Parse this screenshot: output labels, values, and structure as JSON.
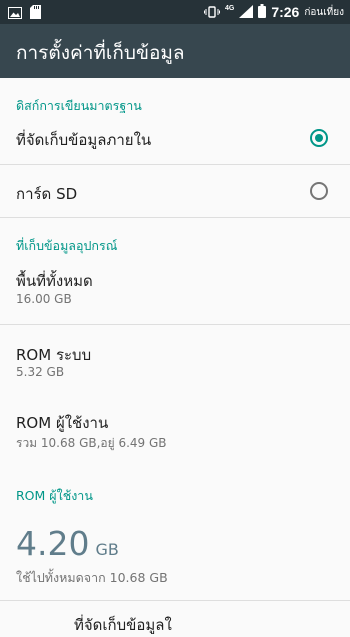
{
  "status_bar": {
    "time": "7:26",
    "ampm": "ก่อนเที่ยง",
    "network": "4G",
    "icons": [
      "image-icon",
      "sd-card-icon",
      "vibrate-icon",
      "signal-icon",
      "battery-icon"
    ]
  },
  "app_bar": {
    "title": "การตั้งค่าที่เก็บข้อมูล"
  },
  "default_disk": {
    "header": "ดิสก์การเขียนมาตรฐาน",
    "options": [
      {
        "label": "ที่จัดเก็บข้อมูลภายใน",
        "selected": true
      },
      {
        "label": "การ์ด SD",
        "selected": false
      }
    ]
  },
  "device_storage": {
    "header": "ที่เก็บข้อมูลอุปกรณ์",
    "items": [
      {
        "title": "พื้นที่ทั้งหมด",
        "value": "16.00 GB"
      },
      {
        "title": "ROM ระบบ",
        "value": "5.32 GB"
      },
      {
        "title": "ROM ผู้ใช้งาน",
        "value": "รวม 10.68 GB,อยู่ 6.49 GB"
      }
    ]
  },
  "user_rom": {
    "header": "ROM ผู้ใช้งาน",
    "used_number": "4.20",
    "used_unit": "GB",
    "caption": "ใช้ไปทั้งหมดจาก 10.68 GB"
  },
  "partial_row": {
    "text": "ที่จัดเก็บข้อมูลใ"
  },
  "colors": {
    "accent": "#009688",
    "app_bar": "#37474f",
    "status_bar": "#263238",
    "big_value": "#607d8b"
  }
}
